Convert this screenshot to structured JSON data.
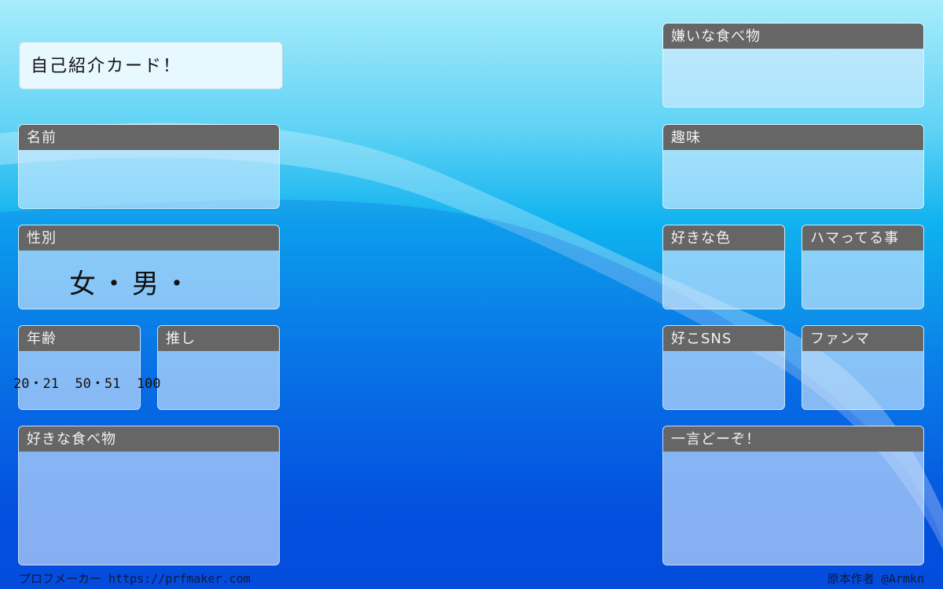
{
  "title": "自己紹介カード！",
  "cards": {
    "name": "名前",
    "gender": "性別",
    "age": "年齢",
    "oshi": "推し",
    "favorite_food": "好きな食べ物",
    "disliked_food": "嫌いな食べ物",
    "hobby": "趣味",
    "favorite_color": "好きな色",
    "hooked_on": "ハマってる事",
    "favorite_sns": "好こSNS",
    "fan_mark": "ファンマ",
    "comment": "一言どーぞ！"
  },
  "gender_options": "女・男・",
  "age_options": "20・21  50・51  100",
  "footer": {
    "left": "プロフメーカー https://prfmaker.com",
    "right": "原本作者 @Armkn"
  }
}
